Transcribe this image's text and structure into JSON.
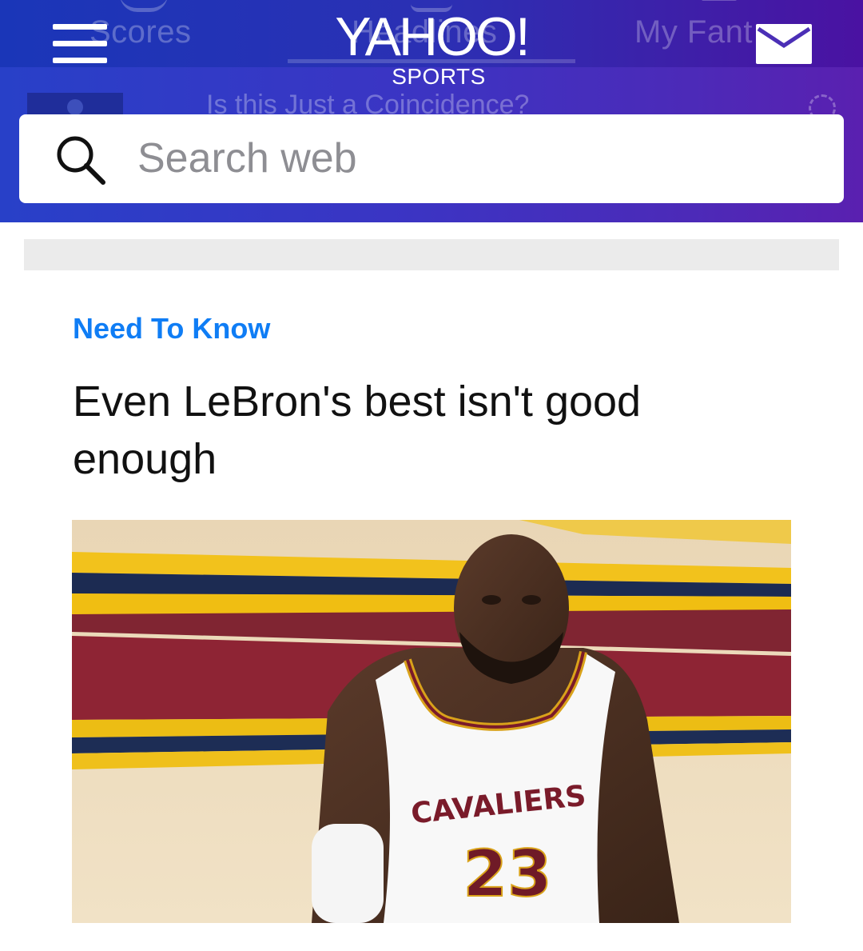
{
  "header": {
    "logo": "YAHOO!",
    "logo_sub": "SPORTS",
    "background_tabs": [
      "Scores",
      "Headlines",
      "My Fant"
    ],
    "background_story": "Is this Just a Coincidence?",
    "icons": {
      "menu": "hamburger-menu-icon",
      "mail": "mail-envelope-icon",
      "search": "search-magnifier-icon"
    }
  },
  "search": {
    "placeholder": "Search web",
    "value": ""
  },
  "article": {
    "kicker": "Need To Know",
    "headline": "Even LeBron's best isn't good enough",
    "image": {
      "jersey_text": "CAVALIERS",
      "jersey_number": "23"
    }
  },
  "colors": {
    "header_gradient_start": "#2840c8",
    "header_gradient_end": "#5a20b0",
    "kicker": "#0f7df5",
    "headline": "#111111",
    "ad_placeholder": "#ebebeb"
  }
}
